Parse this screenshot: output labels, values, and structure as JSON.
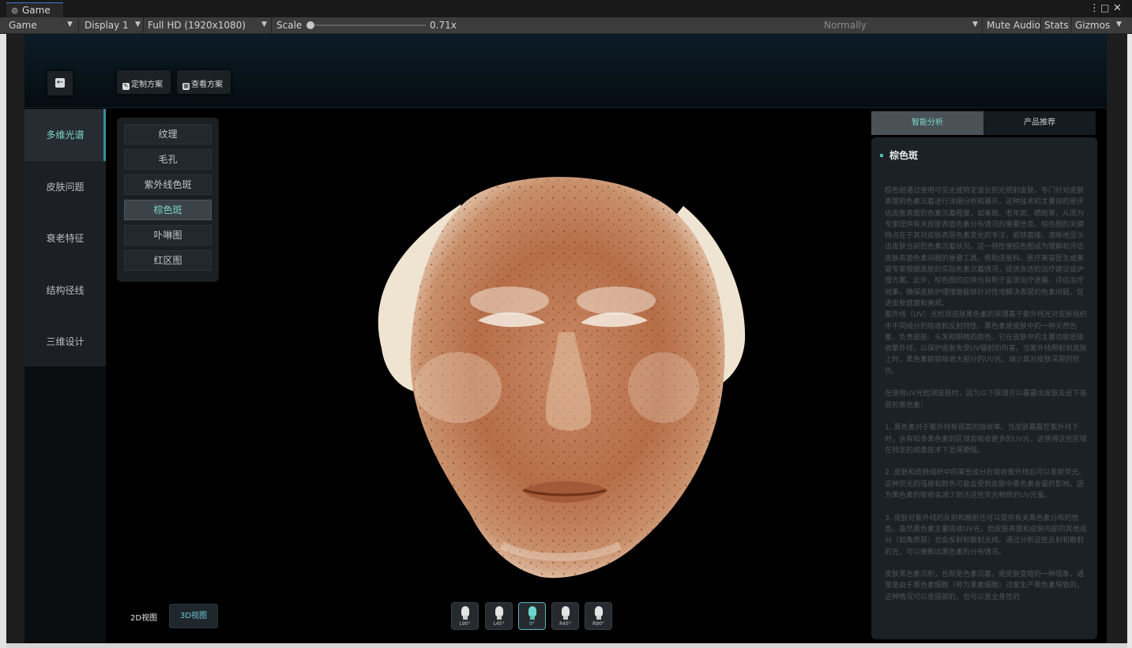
{
  "editor": {
    "tab_title": "Game",
    "tab_icon": "gamepad-icon",
    "toolbar": {
      "view_mode": "Game",
      "display": "Display 1",
      "resolution": "Full HD (1920x1080)",
      "scale_label": "Scale",
      "scale_value": "0.71x",
      "play_focus": "Normally",
      "mute_audio": "Mute Audio",
      "stats": "Stats",
      "gizmos": "Gizmos"
    }
  },
  "app": {
    "header": {
      "custom_plan": "定制方案",
      "view_plan": "查看方案"
    },
    "nav": [
      {
        "label": "多维光谱"
      },
      {
        "label": "皮肤问题"
      },
      {
        "label": "衰老特征"
      },
      {
        "label": "结构径线"
      },
      {
        "label": "三维设计"
      }
    ],
    "sub_items": [
      {
        "label": "纹理"
      },
      {
        "label": "毛孔"
      },
      {
        "label": "紫外线色斑"
      },
      {
        "label": "棕色斑"
      },
      {
        "label": "卟啉图"
      },
      {
        "label": "红区图"
      }
    ],
    "view_toggle": {
      "label_2d": "2D视图",
      "label_3d": "3D视图"
    },
    "angles": [
      {
        "label": "L90°"
      },
      {
        "label": "L45°"
      },
      {
        "label": "0°"
      },
      {
        "label": "R45°"
      },
      {
        "label": "R90°"
      }
    ],
    "right_tabs": [
      {
        "label": "智能分析"
      },
      {
        "label": "产品推荐"
      }
    ],
    "analysis": {
      "title": "棕色斑",
      "body": "棕色斑通过使用可见光或特定波长的光照射皮肤，专门针对皮肤表层的色素沉着进行详细分析和展示。这种技术的主要目的是评估皮肤表面的色素沉着程度，如雀斑、老年斑、晒斑等，从而为专家提供有关皮肤表面色素分布情况的重要信息。棕色图的关键特点在于其对皮肤表层色素变化的专注，能够直接、清晰地显示出皮肤当前的色素沉着状况。这一特性使棕色图成为理解和评估皮肤表面色素问题的重要工具，帮助皮肤科、医疗美容医生或美容专家根据皮肤的实际色素沉着情况，提供合适的治疗建议或护理方案。此外，棕色图的应用也有助于监测治疗进展，评估治疗效果，确保皮肤护理措施能够针对性地解决表层的色素问题，促进皮肤健康和美观。\n紫外线（UV）光检测皮肤黑色素的原理基于紫外线光对皮肤组织中不同成分的吸收和反射特性。黑色素是皮肤中的一种天然色素，负责皮肤、头发和眼睛的颜色。它在皮肤中的主要功能是吸收紫外线，以保护皮肤免受UV辐射的伤害。当紫外线照射到皮肤上时，黑色素能够吸收大部分的UV光，减少其对皮肤深层的损伤。\n\n在使用UV光检测皮肤时，因为以下原理可以暴露出皮肤及皮下各层的黑色素：\n\n1. 黑色素对于紫外线有很高的吸收率。当皮肤暴露在紫外线下时，含有较多黑色素的区域会吸收更多的UV光，这使得这些区域在特定的成像技术下显得更暗。\n\n2. 皮肤和皮肤组织中的某些成分在吸收紫外线后可以发射荧光。这种荧光的强度和颜色可能会受到皮肤中黑色素含量的影响，因为黑色素的吸收会减少到达这些荧光物质的UV光量。\n\n3. 皮肤对紫外线的反射和散射也可以提供有关黑色素分布的信息。虽然黑色素主要吸收UV光，但皮肤表面和皮肤内部的其他成分（如角质层）也会反射和散射光线。通过分析这些反射和散射的光，可以推断出黑色素的分布情况。\n\n皮肤黑色素沉积，也就是色素沉着，是皮肤变暗的一种现象，通常是由于黑色素细胞（称为黑素细胞）过度生产黑色素导致的。这种情况可以是局部的，也可以是全身性的"
    }
  }
}
